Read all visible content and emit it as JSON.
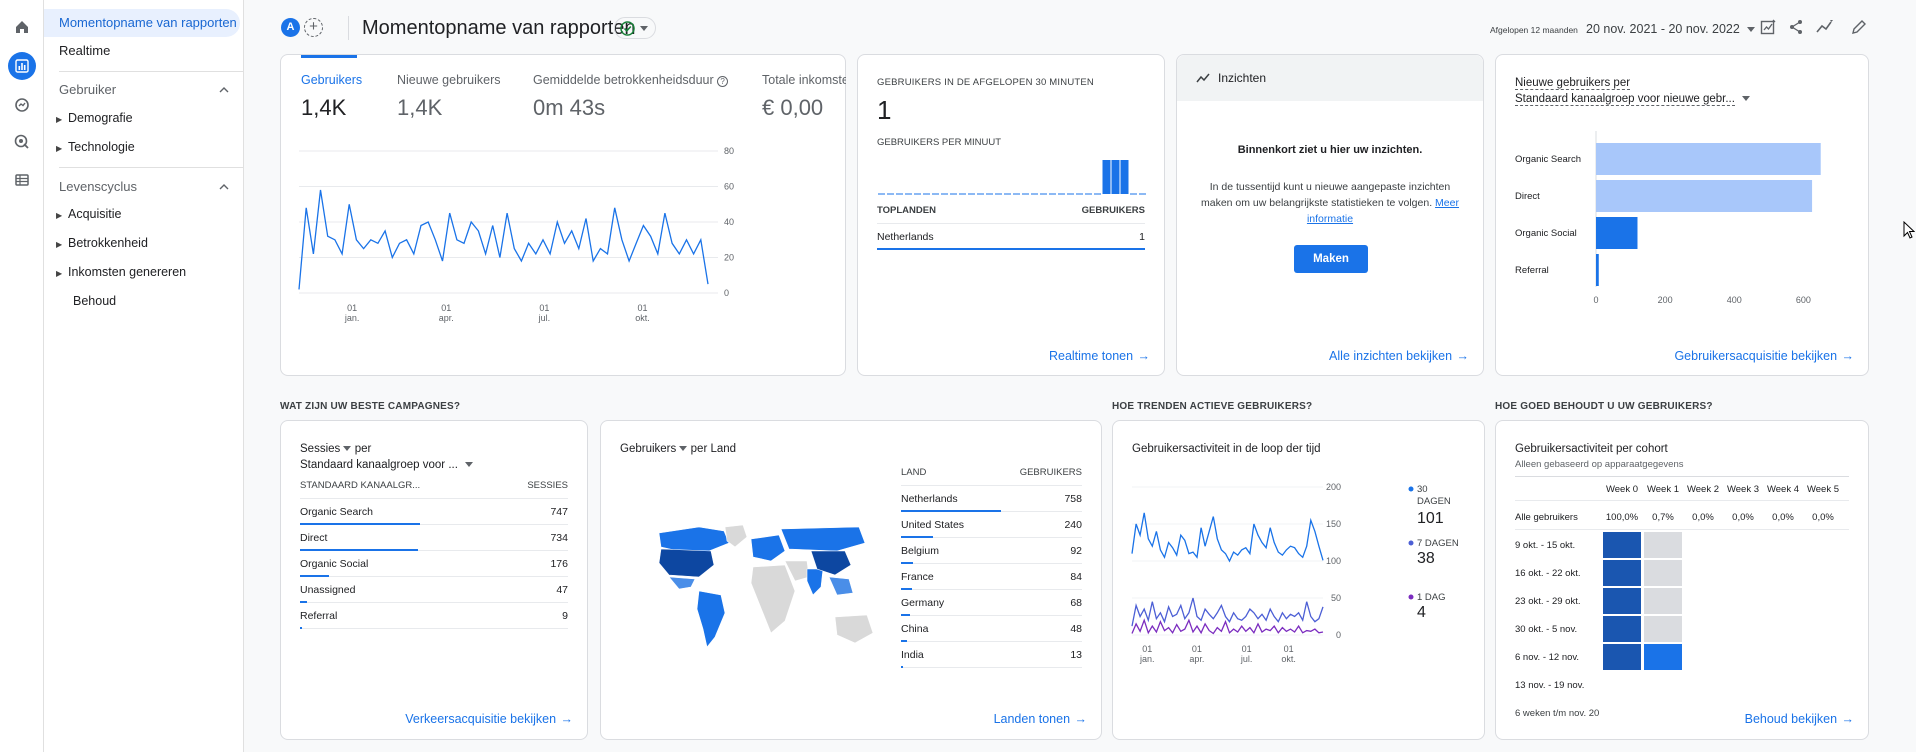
{
  "nav": {
    "active_item": "Momentopname van rapporten",
    "realtime": "Realtime",
    "section_user": "Gebruiker",
    "user_items": [
      "Demografie",
      "Technologie"
    ],
    "section_lifecycle": "Levenscyclus",
    "lifecycle_items": [
      "Acquisitie",
      "Betrokkenheid",
      "Inkomsten genereren",
      "Behoud"
    ]
  },
  "header": {
    "avatar": "A",
    "title": "Momentopname van rapporten",
    "date_label": "Afgelopen 12 maanden",
    "date_range": "20 nov. 2021 - 20 nov. 2022"
  },
  "overview": {
    "metrics": [
      {
        "label": "Gebruikers",
        "value": "1,4K"
      },
      {
        "label": "Nieuwe gebruikers",
        "value": "1,4K"
      },
      {
        "label": "Gemiddelde betrokkenheidsduur",
        "value": "0m 43s"
      },
      {
        "label": "Totale inkomsten",
        "value": "€ 0,00"
      }
    ],
    "y_ticks": [
      "80",
      "60",
      "40",
      "20",
      "0"
    ],
    "x_ticks": [
      {
        "d": "01",
        "m": "jan."
      },
      {
        "d": "01",
        "m": "apr."
      },
      {
        "d": "01",
        "m": "jul."
      },
      {
        "d": "01",
        "m": "okt."
      }
    ]
  },
  "realtime": {
    "title": "GEBRUIKERS IN DE AFGELOPEN 30 MINUTEN",
    "value": "1",
    "per_minute": "GEBRUIKERS PER MINUUT",
    "col_country": "TOPLANDEN",
    "col_users": "GEBRUIKERS",
    "rows": [
      {
        "country": "Netherlands",
        "users": "1"
      }
    ],
    "link": "Realtime tonen"
  },
  "insights": {
    "title": "Inzichten",
    "heading": "Binnenkort ziet u hier uw inzichten.",
    "body": "In de tussentijd kunt u nieuwe aangepaste inzichten maken om uw belangrijkste statistieken te volgen.",
    "more": "Meer informatie",
    "button": "Maken",
    "link": "Alle inzichten bekijken"
  },
  "new_users": {
    "title_line1": "Nieuwe gebruikers per",
    "title_line2": "Standaard kanaalgroep voor nieuwe gebr...",
    "link": "Gebruikersacquisitie bekijken"
  },
  "sections": {
    "campaigns": "WAT ZIJN UW BESTE CAMPAGNES?",
    "trends": "HOE TRENDEN ACTIEVE GEBRUIKERS?",
    "retention": "HOE GOED BEHOUDT U UW GEBRUIKERS?"
  },
  "sessions": {
    "metric": "Sessies",
    "per": "per",
    "dimension": "Standaard kanaalgroep voor ...",
    "col_dim": "STANDAARD KANAALGR...",
    "col_val": "SESSIES",
    "rows": [
      {
        "label": "Organic Search",
        "value": "747",
        "fraction": 1.0
      },
      {
        "label": "Direct",
        "value": "734",
        "fraction": 0.98
      },
      {
        "label": "Organic Social",
        "value": "176",
        "fraction": 0.24
      },
      {
        "label": "Unassigned",
        "value": "47",
        "fraction": 0.06
      },
      {
        "label": "Referral",
        "value": "9",
        "fraction": 0.01
      }
    ],
    "link": "Verkeersacquisitie bekijken"
  },
  "countries": {
    "metric": "Gebruikers",
    "per": "per Land",
    "col_country": "LAND",
    "col_users": "GEBRUIKERS",
    "rows": [
      {
        "label": "Netherlands",
        "value": "758",
        "fraction": 1.0
      },
      {
        "label": "United States",
        "value": "240",
        "fraction": 0.32
      },
      {
        "label": "Belgium",
        "value": "92",
        "fraction": 0.12
      },
      {
        "label": "France",
        "value": "84",
        "fraction": 0.11
      },
      {
        "label": "Germany",
        "value": "68",
        "fraction": 0.09
      },
      {
        "label": "China",
        "value": "48",
        "fraction": 0.06
      },
      {
        "label": "India",
        "value": "13",
        "fraction": 0.02
      }
    ],
    "link": "Landen tonen"
  },
  "activity": {
    "title": "Gebruikersactiviteit in de loop der tijd",
    "y_ticks": [
      "200",
      "150",
      "100",
      "50",
      "0"
    ],
    "x_ticks": [
      {
        "d": "01",
        "m": "jan."
      },
      {
        "d": "01",
        "m": "apr."
      },
      {
        "d": "01",
        "m": "jul."
      },
      {
        "d": "01",
        "m": "okt."
      }
    ],
    "legend": [
      {
        "label_l1": "30",
        "label_l2": "DAGEN",
        "value": "101",
        "color": "#1a73e8"
      },
      {
        "label_l1": "7 DAGEN",
        "label_l2": "",
        "value": "38",
        "color": "#4c5fd5"
      },
      {
        "label_l1": "1 DAG",
        "label_l2": "",
        "value": "4",
        "color": "#7b2cbf"
      }
    ]
  },
  "cohort": {
    "title": "Gebruikersactiviteit per cohort",
    "subtitle": "Alleen gebaseerd op apparaatgegevens",
    "weeks": [
      "Week 0",
      "Week 1",
      "Week 2",
      "Week 3",
      "Week 4",
      "Week 5"
    ],
    "all_label": "Alle gebruikers",
    "all_values": [
      "100,0%",
      "0,7%",
      "0,0%",
      "0,0%",
      "0,0%",
      "0,0%"
    ],
    "rows": [
      "9 okt. - 15 okt.",
      "16 okt. - 22 okt.",
      "23 okt. - 29 okt.",
      "30 okt. - 5 nov.",
      "6 nov. - 12 nov.",
      "13 nov. - 19 nov."
    ],
    "footer": "6 weken t/m nov. 20",
    "link": "Behoud bekijken"
  },
  "chart_data": [
    {
      "type": "line",
      "title": "Gebruikers",
      "xlabel": "",
      "ylabel": "",
      "ylim": [
        0,
        80
      ],
      "x_ticks": [
        "01 jan.",
        "01 apr.",
        "01 jul.",
        "01 okt."
      ],
      "series": [
        {
          "name": "Gebruikers",
          "values": [
            2,
            48,
            22,
            58,
            32,
            30,
            22,
            50,
            30,
            25,
            30,
            28,
            35,
            20,
            28,
            30,
            22,
            38,
            40,
            30,
            18,
            45,
            30,
            28,
            40,
            35,
            22,
            38,
            20,
            45,
            25,
            18,
            28,
            22,
            30,
            22,
            40,
            28,
            35,
            25,
            42,
            18,
            25,
            22,
            48,
            30,
            18,
            28,
            38,
            32,
            22,
            45,
            28,
            22,
            30,
            22,
            30,
            5
          ]
        }
      ]
    },
    {
      "type": "bar",
      "title": "Nieuwe gebruikers per Standaard kanaalgroep voor nieuwe gebr...",
      "orientation": "horizontal",
      "categories": [
        "Organic Search",
        "Direct",
        "Organic Social",
        "Referral"
      ],
      "values": [
        650,
        625,
        120,
        8
      ],
      "xlim": [
        0,
        700
      ],
      "x_ticks": [
        "0",
        "200",
        "400",
        "600"
      ]
    },
    {
      "type": "bar",
      "title": "GEBRUIKERS PER MINUUT",
      "categories": [
        "-29",
        "-28",
        "-27",
        "-26",
        "-25",
        "-24",
        "-23",
        "-22",
        "-21",
        "-20",
        "-19",
        "-18",
        "-17",
        "-16",
        "-15",
        "-14",
        "-13",
        "-12",
        "-11",
        "-10",
        "-9",
        "-8",
        "-7",
        "-6",
        "-5",
        "-4",
        "-3",
        "-2",
        "-1",
        "0"
      ],
      "values": [
        0,
        0,
        0,
        0,
        0,
        0,
        0,
        0,
        0,
        0,
        0,
        0,
        0,
        0,
        0,
        0,
        0,
        0,
        0,
        0,
        0,
        0,
        0,
        0,
        0,
        1,
        1,
        1,
        0,
        0
      ]
    },
    {
      "type": "line",
      "title": "Gebruikersactiviteit in de loop der tijd",
      "ylim": [
        0,
        200
      ],
      "x_ticks": [
        "01 jan.",
        "01 apr.",
        "01 jul.",
        "01 okt."
      ],
      "series": [
        {
          "name": "30 DAGEN",
          "values": [
            110,
            150,
            135,
            165,
            130,
            120,
            140,
            115,
            105,
            125,
            118,
            108,
            135,
            128,
            110,
            112,
            105,
            145,
            120,
            140,
            160,
            130,
            115,
            110,
            100,
            112,
            108,
            115,
            118,
            110,
            150,
            135,
            125,
            118,
            145,
            125,
            112,
            108,
            115,
            120,
            118,
            110,
            105,
            120,
            155,
            140,
            120,
            101
          ]
        },
        {
          "name": "7 DAGEN",
          "values": [
            12,
            40,
            25,
            35,
            20,
            45,
            22,
            30,
            18,
            38,
            25,
            28,
            40,
            22,
            30,
            50,
            25,
            20,
            35,
            28,
            22,
            30,
            40,
            25,
            18,
            30,
            22,
            20,
            25,
            35,
            30,
            22,
            28,
            20,
            35,
            25,
            18,
            30,
            22,
            28,
            25,
            30,
            20,
            45,
            25,
            18,
            22,
            38
          ]
        },
        {
          "name": "1 DAG",
          "values": [
            2,
            15,
            5,
            20,
            3,
            12,
            4,
            18,
            6,
            10,
            3,
            14,
            5,
            8,
            20,
            4,
            12,
            3,
            15,
            6,
            2,
            10,
            5,
            18,
            3,
            8,
            4,
            12,
            5,
            10,
            3,
            15,
            4,
            8,
            6,
            12,
            3,
            10,
            5,
            8,
            4,
            12,
            3,
            6,
            5,
            8,
            3,
            4
          ]
        }
      ],
      "legend": "right"
    }
  ]
}
